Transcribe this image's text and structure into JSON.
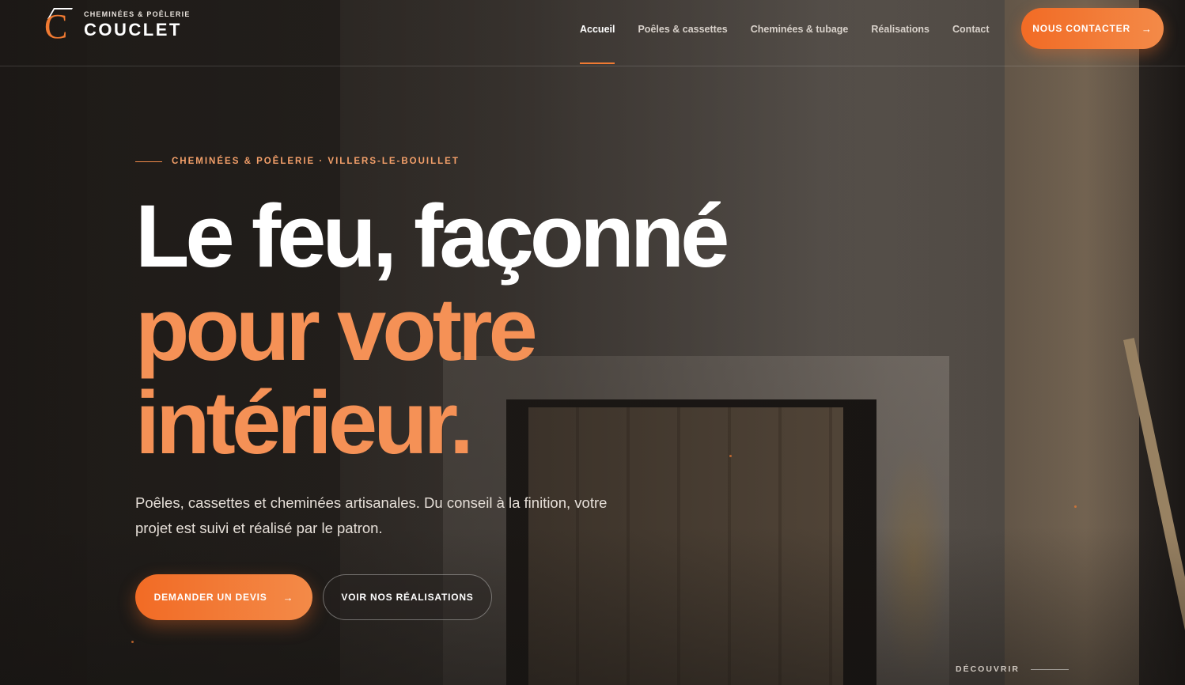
{
  "brand": {
    "kicker": "CHEMINÉES & POÊLERIE",
    "name": "COUCLET",
    "logo_letter": "C"
  },
  "nav": {
    "items": [
      {
        "label": "Accueil",
        "active": true
      },
      {
        "label": "Poêles & cassettes",
        "active": false
      },
      {
        "label": "Cheminées & tubage",
        "active": false
      },
      {
        "label": "Réalisations",
        "active": false
      },
      {
        "label": "Contact",
        "active": false
      }
    ],
    "cta_label": "NOUS CONTACTER",
    "cta_arrow": "→"
  },
  "hero": {
    "eyebrow": "CHEMINÉES & POÊLERIE · VILLERS-LE-BOUILLET",
    "headline_line1": "Le feu, façonné",
    "headline_line2": "pour votre",
    "headline_line3": "intérieur.",
    "lead": "Poêles, cassettes et cheminées artisanales. Du conseil à la finition, votre projet est suivi et réalisé par le patron.",
    "primary_button": "DEMANDER UN DEVIS",
    "primary_arrow": "→",
    "secondary_button": "VOIR NOS RÉALISATIONS",
    "scroll_label": "DÉCOUVRIR"
  },
  "colors": {
    "accent": "#f07a32",
    "headline_accent": "#f59156"
  },
  "icons": {
    "logo": "logo-mark-icon",
    "arrow": "arrow-right-icon"
  }
}
